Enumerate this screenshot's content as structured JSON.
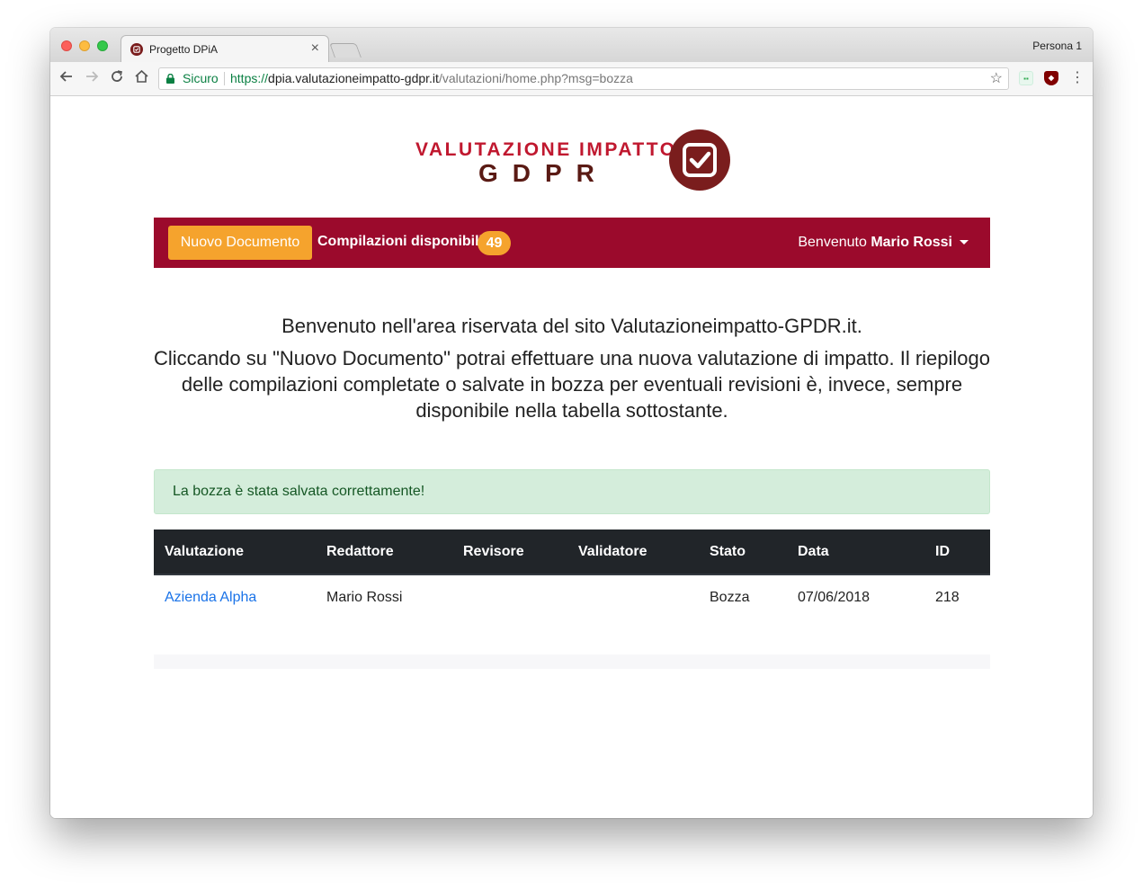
{
  "browser": {
    "tab_title": "Progetto DPiA",
    "tab_close": "×",
    "profile": "Persona 1",
    "secure_label": "Sicuro",
    "url_scheme": "https://",
    "url_host": "dpia.valutazioneimpatto-gdpr.it",
    "url_path": "/valutazioni/home.php?msg=bozza"
  },
  "logo": {
    "line1": "VALUTAZIONE IMPATTO",
    "line2": "GDPR"
  },
  "navbar": {
    "new_document_label": "Nuovo Documento",
    "available_label": "Compilazioni disponibili:",
    "available_count": "49",
    "welcome_prefix": "Benvenuto",
    "user_name": "Mario Rossi"
  },
  "intro": {
    "line1": "Benvenuto nell'area riservata del sito Valutazioneimpatto-GPDR.it.",
    "line2": "Cliccando su \"Nuovo Documento\" potrai effettuare una nuova valutazione di impatto. Il riepilogo delle compilazioni completate o salvate in bozza per eventuali revisioni è, invece, sempre disponibile nella tabella sottostante."
  },
  "alert": {
    "message": "La bozza è stata salvata correttamente!"
  },
  "table": {
    "headers": [
      "Valutazione",
      "Redattore",
      "Revisore",
      "Validatore",
      "Stato",
      "Data",
      "ID"
    ],
    "rows": [
      {
        "valutazione": "Azienda Alpha",
        "redattore": "Mario Rossi",
        "revisore": "",
        "validatore": "",
        "stato": "Bozza",
        "data": "07/06/2018",
        "id": "218"
      }
    ]
  },
  "colors": {
    "brand": "#9b0a2c",
    "accent": "#f5a32d",
    "logo_dark": "#7a1d1d"
  }
}
